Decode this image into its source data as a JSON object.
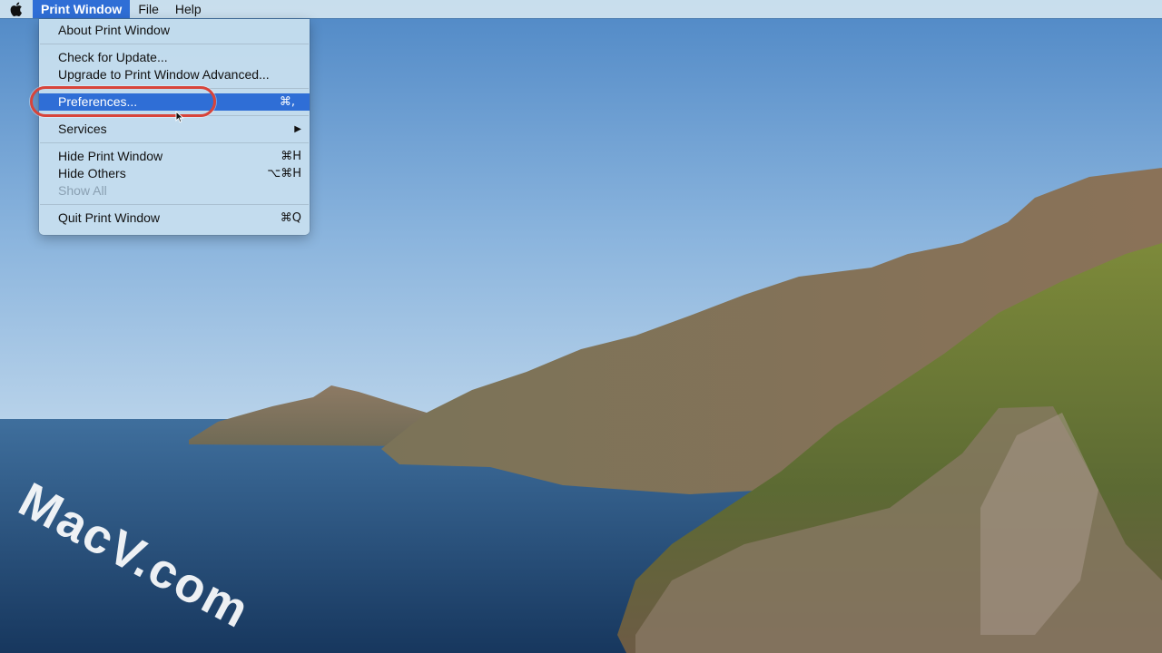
{
  "menubar": {
    "apple_icon": "apple-logo-icon",
    "items": [
      "Print Window",
      "File",
      "Help"
    ],
    "active_item": "Print Window"
  },
  "menu": {
    "about": "About Print Window",
    "check_update": "Check for Update...",
    "upgrade": "Upgrade to Print Window Advanced...",
    "preferences": "Preferences...",
    "preferences_shortcut": "⌘,",
    "services": "Services",
    "services_submenu_icon": "▶",
    "hide": "Hide Print Window",
    "hide_shortcut": "⌘H",
    "hide_others": "Hide Others",
    "hide_others_shortcut": "⌥⌘H",
    "show_all": "Show All",
    "quit": "Quit Print Window",
    "quit_shortcut": "⌘Q"
  },
  "watermark": "MacV.com",
  "colors": {
    "highlight": "#2f6ed6",
    "callout": "#d8443a",
    "sky": "#5e93cb",
    "sea": "#234f7e"
  }
}
